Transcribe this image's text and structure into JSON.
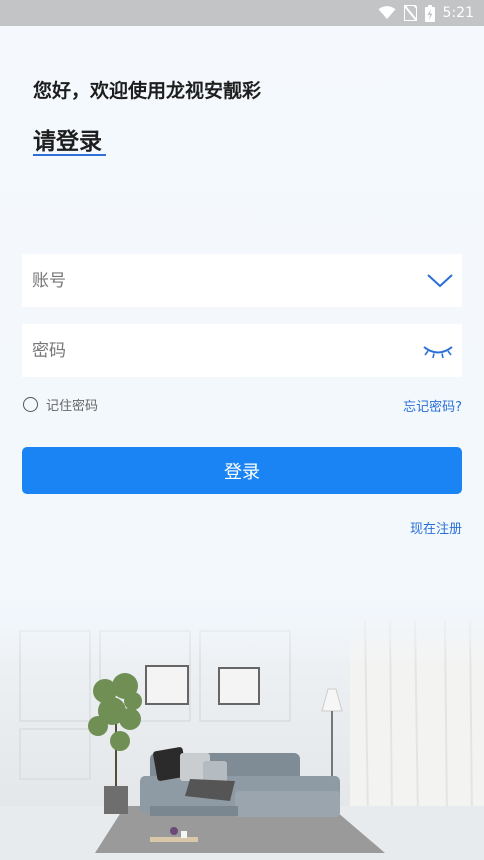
{
  "status_bar": {
    "time": "5:21",
    "icons": [
      "wifi-icon",
      "no-sim-icon",
      "battery-charging-icon"
    ]
  },
  "header": {
    "greeting": "您好，欢迎使用龙视安靓彩",
    "title": "请登录"
  },
  "form": {
    "account_placeholder": "账号",
    "password_placeholder": "密码",
    "remember_label": "记住密码",
    "forgot_link": "忘记密码?",
    "login_button": "登录",
    "register_link": "现在注册"
  },
  "icons": {
    "account_dropdown": "chevron-down-icon",
    "password_toggle": "eye-closed-icon"
  },
  "colors": {
    "accent": "#1a84f4",
    "link": "#2a6fd6",
    "title_underline": "#2f6fd8"
  }
}
